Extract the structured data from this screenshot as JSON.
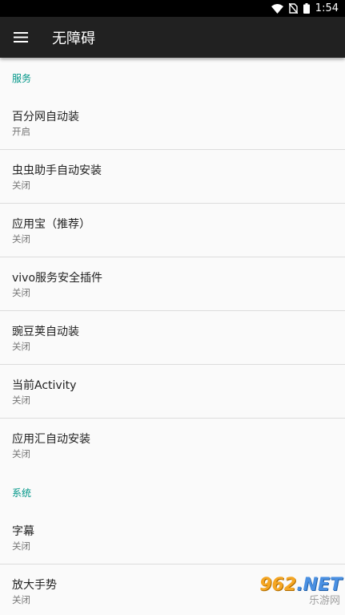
{
  "status_bar": {
    "time": "1:54",
    "icons": [
      "wifi-icon",
      "no-sim-icon",
      "battery-icon"
    ]
  },
  "app_bar": {
    "title": "无障碍",
    "menu_icon": "hamburger-menu-icon"
  },
  "sections": [
    {
      "header": "服务",
      "items": [
        {
          "title": "百分网自动装",
          "summary": "开启"
        },
        {
          "title": "虫虫助手自动安装",
          "summary": "关闭"
        },
        {
          "title": "应用宝（推荐）",
          "summary": "关闭"
        },
        {
          "title": "vivo服务安全插件",
          "summary": "关闭"
        },
        {
          "title": "豌豆荚自动装",
          "summary": "关闭"
        },
        {
          "title": "当前Activity",
          "summary": "关闭"
        },
        {
          "title": "应用汇自动安装",
          "summary": "关闭"
        }
      ]
    },
    {
      "header": "系统",
      "items": [
        {
          "title": "字幕",
          "summary": "关闭"
        },
        {
          "title": "放大手势",
          "summary": "关闭"
        }
      ]
    }
  ],
  "watermark": {
    "brand_num": "962",
    "brand_net": ".NET",
    "sub": "乐游网"
  },
  "colors": {
    "app_bar": "#212121",
    "accent": "#009688",
    "background": "#fafafa"
  }
}
